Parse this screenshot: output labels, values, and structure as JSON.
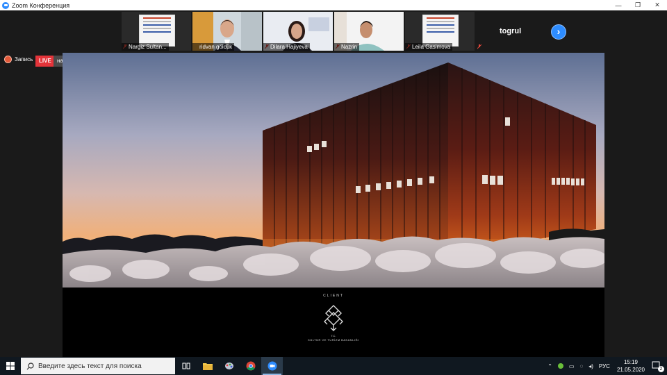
{
  "window": {
    "title": "Zoom Конференция"
  },
  "participants": [
    {
      "name": "Nargiz Sultan..."
    },
    {
      "name": "ridvan gölcük"
    },
    {
      "name": "Dilara Hajiyeva"
    },
    {
      "name": "Nazrin"
    },
    {
      "name": "Leila Gasimova"
    },
    {
      "name": "togrul"
    }
  ],
  "recording": {
    "label": "Запись",
    "live": "LIVE",
    "destination": "на Facebook"
  },
  "shared": {
    "client_label": "CLIENT",
    "ministry_abbr": "T.C.",
    "ministry_name": "KÜLTÜR VE TURİZM BAKANLIĞI"
  },
  "taskbar": {
    "search_placeholder": "Введите здесь текст для поиска",
    "language": "РУС",
    "time": "15:19",
    "date": "21.05.2020",
    "notifications": "2"
  },
  "colors": {
    "zoom_blue": "#2d8cff",
    "live_red": "#e4343a",
    "taskbar": "#101820"
  }
}
